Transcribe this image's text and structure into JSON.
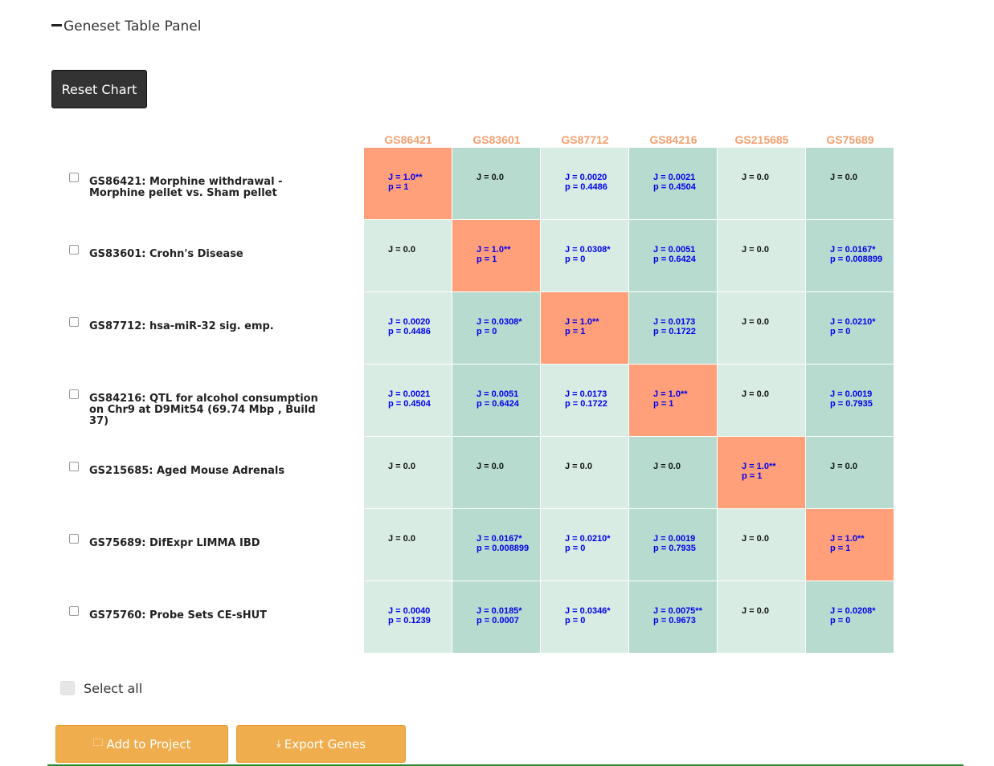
{
  "panel": {
    "title": "Geneset Table Panel"
  },
  "toolbar": {
    "reset_label": "Reset Chart"
  },
  "columns": [
    "GS86421",
    "GS83601",
    "GS87712",
    "GS84216",
    "GS215685",
    "GS75689"
  ],
  "rows": [
    {
      "label": "GS86421: Morphine withdrawal - Morphine pellet vs. Sham pellet"
    },
    {
      "label": "GS83601: Crohn's Disease"
    },
    {
      "label": "GS87712: hsa-miR-32 sig. emp."
    },
    {
      "label": "GS84216: QTL for alcohol consumption on Chr9 at D9Mit54 (69.74 Mbp , Build 37)"
    },
    {
      "label": "GS215685: Aged Mouse Adrenals"
    },
    {
      "label": "GS75689: DifExpr LIMMA IBD"
    },
    {
      "label": "GS75760: Probe Sets CE-sHUT"
    }
  ],
  "matrix": [
    [
      [
        "J = 1.0**",
        "p = 1"
      ],
      [
        "J = 0.0"
      ],
      [
        "J = 0.0020",
        "p = 0.4486"
      ],
      [
        "J = 0.0021",
        "p = 0.4504"
      ],
      [
        "J = 0.0"
      ],
      [
        "J = 0.0"
      ]
    ],
    [
      [
        "J = 0.0"
      ],
      [
        "J = 1.0**",
        "p = 1"
      ],
      [
        "J = 0.0308*",
        "p = 0"
      ],
      [
        "J = 0.0051",
        "p = 0.6424"
      ],
      [
        "J = 0.0"
      ],
      [
        "J = 0.0167*",
        "p = 0.008899"
      ]
    ],
    [
      [
        "J = 0.0020",
        "p = 0.4486"
      ],
      [
        "J = 0.0308*",
        "p = 0"
      ],
      [
        "J = 1.0**",
        "p = 1"
      ],
      [
        "J = 0.0173",
        "p = 0.1722"
      ],
      [
        "J = 0.0"
      ],
      [
        "J = 0.0210*",
        "p = 0"
      ]
    ],
    [
      [
        "J = 0.0021",
        "p = 0.4504"
      ],
      [
        "J = 0.0051",
        "p = 0.6424"
      ],
      [
        "J = 0.0173",
        "p = 0.1722"
      ],
      [
        "J = 1.0**",
        "p = 1"
      ],
      [
        "J = 0.0"
      ],
      [
        "J = 0.0019",
        "p = 0.7935"
      ]
    ],
    [
      [
        "J = 0.0"
      ],
      [
        "J = 0.0"
      ],
      [
        "J = 0.0"
      ],
      [
        "J = 0.0"
      ],
      [
        "J = 1.0**",
        "p = 1"
      ],
      [
        "J = 0.0"
      ]
    ],
    [
      [
        "J = 0.0"
      ],
      [
        "J = 0.0167*",
        "p = 0.008899"
      ],
      [
        "J = 0.0210*",
        "p = 0"
      ],
      [
        "J = 0.0019",
        "p = 0.7935"
      ],
      [
        "J = 0.0"
      ],
      [
        "J = 1.0**",
        "p = 1"
      ]
    ],
    [
      [
        "J = 0.0040",
        "p = 0.1239"
      ],
      [
        "J = 0.0185*",
        "p = 0.0007"
      ],
      [
        "J = 0.0346*",
        "p = 0"
      ],
      [
        "J = 0.0075**",
        "p = 0.9673"
      ],
      [
        "J = 0.0"
      ],
      [
        "J = 0.0208*",
        "p = 0"
      ]
    ]
  ],
  "select_all_label": "Select all",
  "buttons": {
    "add_label": "Add to Project",
    "add_icon": "folder-icon",
    "export_label": "Export Genes",
    "export_icon": "download-icon"
  },
  "colors": {
    "header": "#f5a070",
    "diag": "#ffa07a",
    "cell_light": "#d8ece4",
    "cell_dark": "#b8dbd0",
    "value_text": "#0000ee",
    "action_button": "#f0ad4e"
  }
}
